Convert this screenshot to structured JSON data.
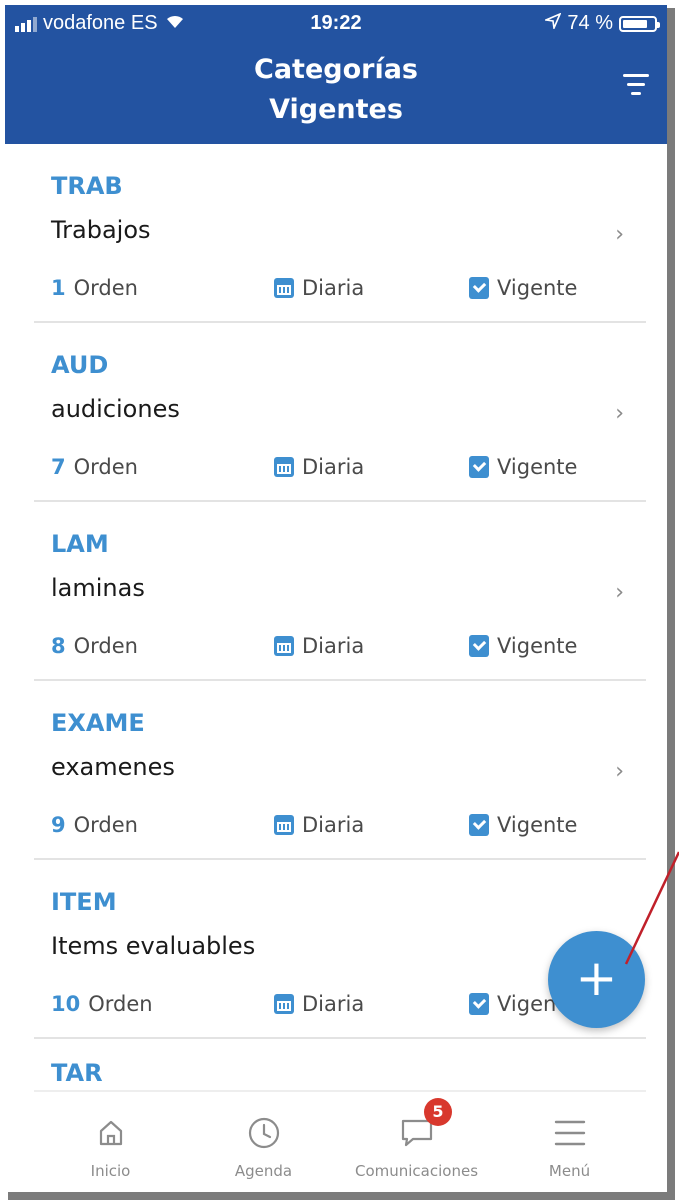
{
  "status_bar": {
    "carrier": "vodafone ES",
    "time": "19:22",
    "battery": "74 %"
  },
  "header": {
    "title_line1": "Categorías",
    "title_line2": "Vigentes"
  },
  "items": [
    {
      "code": "TRAB",
      "name": "Trabajos",
      "order_num": "1",
      "order_label": "Orden",
      "frequency": "Diaria",
      "state": "Vigente"
    },
    {
      "code": "AUD",
      "name": "audiciones",
      "order_num": "7",
      "order_label": "Orden",
      "frequency": "Diaria",
      "state": "Vigente"
    },
    {
      "code": "LAM",
      "name": "laminas",
      "order_num": "8",
      "order_label": "Orden",
      "frequency": "Diaria",
      "state": "Vigente"
    },
    {
      "code": "EXAME",
      "name": "examenes",
      "order_num": "9",
      "order_label": "Orden",
      "frequency": "Diaria",
      "state": "Vigente"
    },
    {
      "code": "ITEM",
      "name": "Items evaluables",
      "order_num": "10",
      "order_label": "Orden",
      "frequency": "Diaria",
      "state": "Vigente"
    },
    {
      "code": "TAR"
    }
  ],
  "fab": {
    "label": "+"
  },
  "tabbar": {
    "tabs": [
      {
        "label": "Inicio"
      },
      {
        "label": "Agenda"
      },
      {
        "label": "Comunicaciones",
        "badge": "5"
      },
      {
        "label": "Menú"
      }
    ]
  },
  "colors": {
    "primary": "#2353a1",
    "accent": "#3e8fd0",
    "badge": "#d8382d",
    "annotation": "#c0202a"
  }
}
